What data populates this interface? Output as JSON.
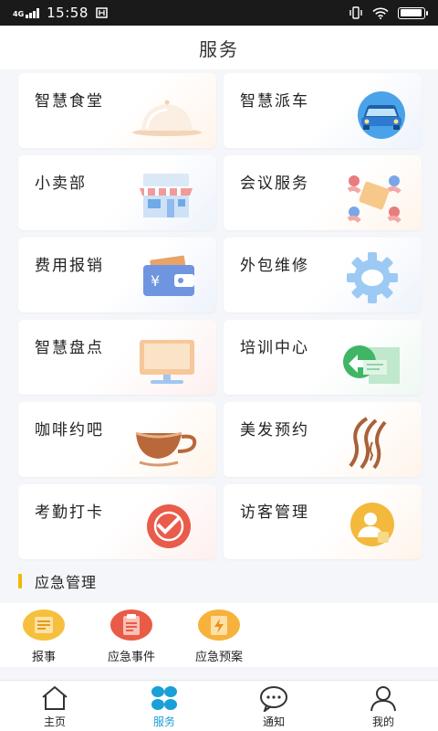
{
  "status_bar": {
    "network": "4G",
    "time": "15:58",
    "battery_level": 0.95
  },
  "header": {
    "title": "服务"
  },
  "services": [
    {
      "label": "智慧食堂",
      "icon": "cloche-icon"
    },
    {
      "label": "智慧派车",
      "icon": "car-icon"
    },
    {
      "label": "小卖部",
      "icon": "store-icon"
    },
    {
      "label": "会议服务",
      "icon": "meeting-icon"
    },
    {
      "label": "费用报销",
      "icon": "wallet-icon"
    },
    {
      "label": "外包维修",
      "icon": "gear-icon"
    },
    {
      "label": "智慧盘点",
      "icon": "monitor-icon"
    },
    {
      "label": "培训中心",
      "icon": "training-icon"
    },
    {
      "label": "咖啡约吧",
      "icon": "coffee-cup-icon"
    },
    {
      "label": "美发预约",
      "icon": "hair-icon"
    },
    {
      "label": "考勤打卡",
      "icon": "checkin-icon"
    },
    {
      "label": "访客管理",
      "icon": "visitor-icon"
    }
  ],
  "emergency": {
    "title": "应急管理",
    "items": [
      {
        "label": "报事",
        "icon": "report-icon"
      },
      {
        "label": "应急事件",
        "icon": "event-clipboard-icon"
      },
      {
        "label": "应急预案",
        "icon": "plan-icon"
      }
    ]
  },
  "tabbar": {
    "tabs": [
      {
        "label": "主页",
        "icon": "home-icon"
      },
      {
        "label": "服务",
        "icon": "services-grid-icon"
      },
      {
        "label": "通知",
        "icon": "chat-bubble-icon"
      },
      {
        "label": "我的",
        "icon": "user-icon"
      }
    ],
    "active_index": 1
  },
  "colors": {
    "accent": "#1a9fd6",
    "section_bar": "#f2b705"
  }
}
